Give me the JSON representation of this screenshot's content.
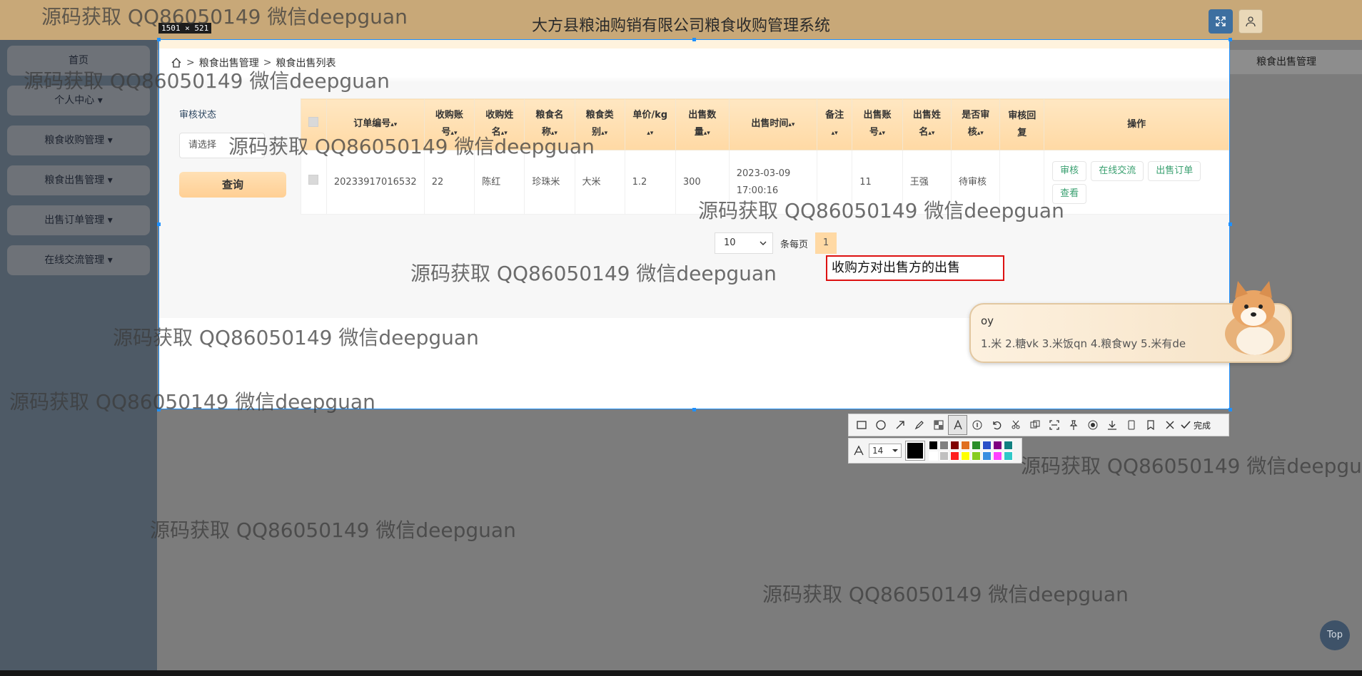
{
  "app": {
    "title": "大方县粮油购销有限公司粮食收购管理系统",
    "tab_current": "粮食出售管理"
  },
  "sidebar": {
    "items": [
      {
        "label": "首页"
      },
      {
        "label": "个人中心 ▾"
      },
      {
        "label": "粮食收购管理 ▾"
      },
      {
        "label": "粮食出售管理 ▾"
      },
      {
        "label": "出售订单管理 ▾"
      },
      {
        "label": "在线交流管理 ▾"
      }
    ]
  },
  "capture": {
    "size_label": "1501 × 521"
  },
  "breadcrumb": {
    "home_icon": "home-icon",
    "level1": "粮食出售管理",
    "level2": "粮食出售列表",
    "separator": ">"
  },
  "filter": {
    "label": "审核状态",
    "select_value": "请选择",
    "query_button": "查询"
  },
  "table": {
    "headers": [
      {
        "l1": "订单编号",
        "l2": ""
      },
      {
        "l1": "收购账",
        "l2": "号"
      },
      {
        "l1": "收购姓",
        "l2": "名"
      },
      {
        "l1": "粮食名",
        "l2": "称"
      },
      {
        "l1": "粮食类",
        "l2": "别"
      },
      {
        "l1": "单价/kg",
        "l2": ""
      },
      {
        "l1": "出售数",
        "l2": "量"
      },
      {
        "l1": "出售时间",
        "l2": ""
      },
      {
        "l1": "备注",
        "l2": ""
      },
      {
        "l1": "出售账",
        "l2": "号"
      },
      {
        "l1": "出售姓",
        "l2": "名"
      },
      {
        "l1": "是否审",
        "l2": "核"
      },
      {
        "l1": "审核回",
        "l2": "复"
      },
      {
        "l1": "操作",
        "l2": ""
      }
    ],
    "rows": [
      {
        "order_no": "20233917016532",
        "buyer_account": "22",
        "buyer_name": "陈红",
        "grain_name": "珍珠米",
        "grain_type": "大米",
        "unit_price": "1.2",
        "quantity": "300",
        "sale_date": "2023-03-09",
        "sale_time": "17:00:16",
        "remark": "",
        "seller_account": "11",
        "seller_name": "王强",
        "audit_status": "待审核",
        "audit_reply": "",
        "actions": [
          "审核",
          "在线交流",
          "出售订单",
          "查看"
        ]
      }
    ]
  },
  "pagination": {
    "page_size": "10",
    "unit_label": "条每页",
    "current_page": "1"
  },
  "annotation": {
    "text": "收购方对出售方的出售"
  },
  "ime": {
    "input": "oy",
    "candidates": "1.米  2.糖vk  3.米饭qn  4.粮食wy  5.米有de"
  },
  "toolbar": {
    "tools": [
      "rectangle-icon",
      "ellipse-icon",
      "arrow-icon",
      "pen-icon",
      "mosaic-icon",
      "text-icon",
      "number-icon",
      "undo-icon",
      "scissor-icon",
      "ocr-icon",
      "scan-icon",
      "pin-icon",
      "record-icon",
      "download-icon",
      "copy-icon",
      "bookmark-icon",
      "close-icon"
    ],
    "done_label": "完成",
    "font_size": "14"
  },
  "colors": {
    "accent": "#ffd9a4",
    "palette": [
      "#000000",
      "#808080",
      "#800000",
      "#e07020",
      "#2a8f2a",
      "#2a50c8",
      "#800080",
      "#108080",
      "#ffffff",
      "#c0c0c0",
      "#ff2020",
      "#ffff00",
      "#88cc22",
      "#3a8fe0",
      "#ff40ff",
      "#30c8c8"
    ]
  },
  "watermark": {
    "text": "源码获取 QQ86050149 微信deepguan"
  },
  "top_button": "Top"
}
